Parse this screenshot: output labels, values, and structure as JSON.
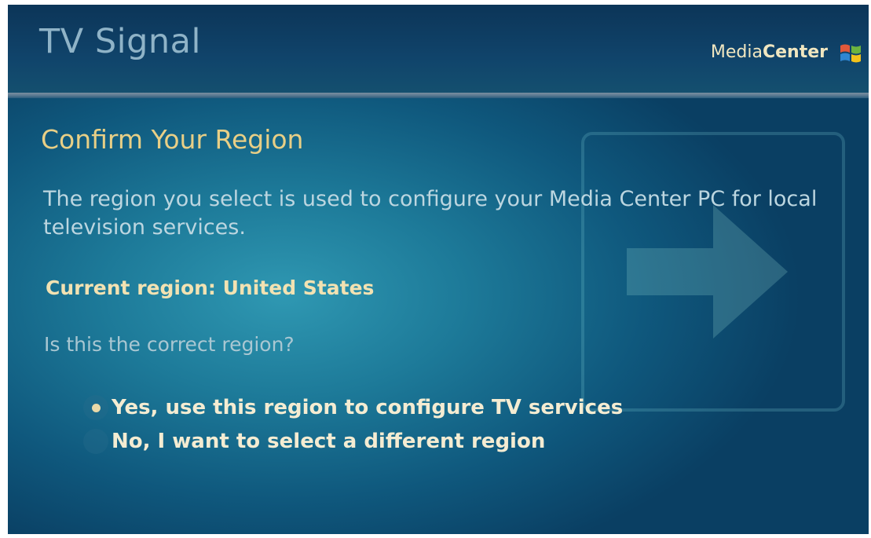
{
  "header": {
    "title": "TV Signal",
    "brand_regular": "Media",
    "brand_bold": "Center"
  },
  "main": {
    "heading": "Confirm Your Region",
    "description": "The region you select is used to configure your Media Center PC for local television services.",
    "current_region": "Current region: United States",
    "question": "Is this the correct region?",
    "options": [
      {
        "label": "Yes, use this region to configure TV services",
        "selected": true
      },
      {
        "label": "No, I want to select a different region",
        "selected": false
      }
    ]
  },
  "colors": {
    "background": "#1d7a99",
    "header": "#0c3558",
    "heading": "#e8cf86",
    "title": "#8fb3c7"
  },
  "icons": {
    "brand": "windows-flag-icon",
    "watermark": "arrow-right-icon"
  }
}
